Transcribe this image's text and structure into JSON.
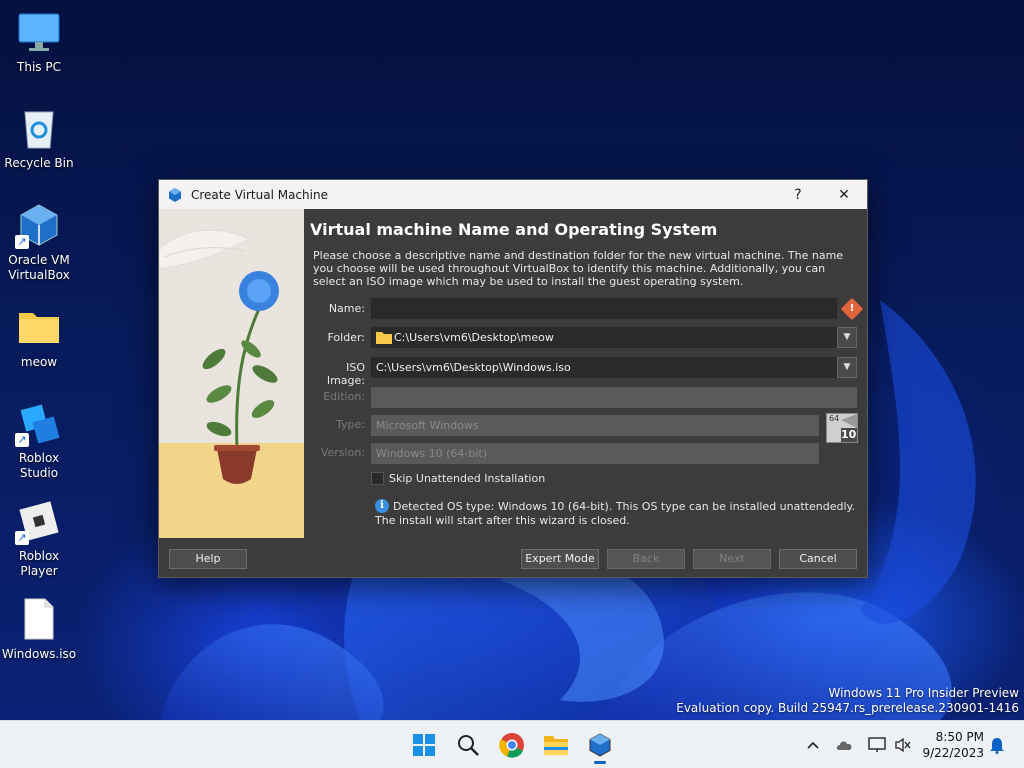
{
  "desktop": {
    "icons": [
      {
        "label": "This PC",
        "icon": "monitor-icon"
      },
      {
        "label": "Recycle Bin",
        "icon": "recycle-bin-icon"
      },
      {
        "label": "Oracle VM\nVirtualBox",
        "icon": "virtualbox-icon"
      },
      {
        "label": "meow",
        "icon": "folder-icon"
      },
      {
        "label": "Roblox Studio",
        "icon": "roblox-studio-icon"
      },
      {
        "label": "Roblox Player",
        "icon": "roblox-player-icon"
      },
      {
        "label": "Windows.iso",
        "icon": "file-icon"
      }
    ]
  },
  "dialog": {
    "title": "Create Virtual Machine",
    "help_glyph": "?",
    "close_glyph": "✕",
    "heading": "Virtual machine Name and Operating System",
    "description": "Please choose a descriptive name and destination folder for the new virtual machine. The name you choose will be used throughout VirtualBox to identify this machine. Additionally, you can select an ISO image which may be used to install the guest operating system.",
    "fields": {
      "name_label": "Name:",
      "name_value": "",
      "folder_label": "Folder:",
      "folder_value": "C:\\Users\\vm6\\Desktop\\meow",
      "iso_label": "ISO Image:",
      "iso_value": "C:\\Users\\vm6\\Desktop\\Windows.iso",
      "edition_label": "Edition:",
      "edition_value": "",
      "type_label": "Type:",
      "type_value": "Microsoft Windows",
      "version_label": "Version:",
      "version_value": "Windows 10 (64-bit)"
    },
    "os_badge": {
      "bits": "64",
      "version": "10"
    },
    "skip_unattended_label": "Skip Unattended Installation",
    "skip_unattended_checked": false,
    "info_text": "Detected OS type: Windows 10 (64-bit). This OS type can be installed unattendedly. The install will start after this wizard is closed.",
    "buttons": {
      "help": "Help",
      "expert": "Expert Mode",
      "back": "Back",
      "next": "Next",
      "cancel": "Cancel"
    }
  },
  "watermark": {
    "line1": "Windows 11 Pro Insider Preview",
    "line2": "Evaluation copy. Build 25947.rs_prerelease.230901-1416"
  },
  "taskbar": {
    "apps": [
      "start-icon",
      "search-icon",
      "chrome-icon",
      "file-explorer-icon",
      "virtualbox-icon"
    ],
    "tray": [
      "chevron-up-icon",
      "onedrive-icon",
      "network-icon",
      "volume-muted-icon"
    ],
    "time": "8:50 PM",
    "date": "9/22/2023"
  },
  "colors": {
    "dialog_bg": "#3c3c3c",
    "field_bg": "#2a2a2a",
    "accent": "#0a64c8",
    "warning": "#e0653a"
  }
}
